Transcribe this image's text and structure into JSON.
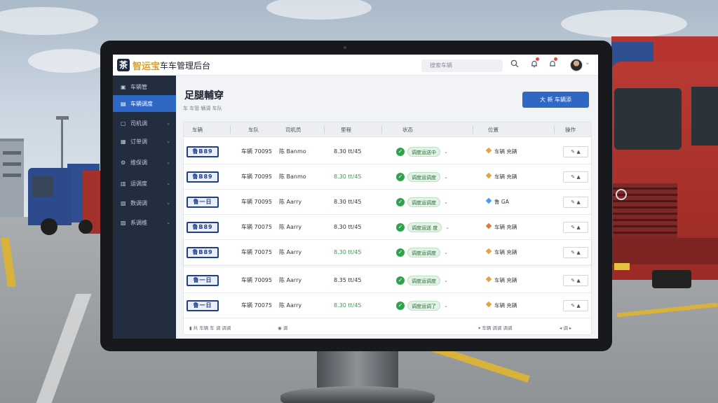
{
  "app": {
    "logo_glyph": "茶",
    "brand_name": "智运宝",
    "brand_suffix": "车车管理后台"
  },
  "topbar": {
    "search_placeholder": "搜索车辆",
    "search_icon": "search-icon",
    "bell_icon": "bell-icon",
    "alert_icon": "alert-icon"
  },
  "sidebar": {
    "items": [
      {
        "label": "车辆管",
        "icon": "dashboard-icon",
        "active": false,
        "caret": false
      },
      {
        "label": "车辆调度",
        "icon": "truck-icon",
        "active": true,
        "caret": false
      },
      {
        "label": "司机调",
        "icon": "driver-icon",
        "active": false,
        "caret": true
      },
      {
        "label": "订单调",
        "icon": "order-icon",
        "active": false,
        "caret": true
      },
      {
        "label": "维保调",
        "icon": "maintenance-icon",
        "active": false,
        "caret": true
      },
      {
        "label": "运调度",
        "icon": "route-icon",
        "active": false,
        "caret": true
      },
      {
        "label": "数调调",
        "icon": "data-icon",
        "active": false,
        "caret": true
      },
      {
        "label": "系调维",
        "icon": "settings-icon",
        "active": false,
        "caret": true
      }
    ]
  },
  "page": {
    "title": "足腿輔穿",
    "subtitle": "车 车管 辆调 车队",
    "primary_button": "大 新 车辆添"
  },
  "table": {
    "headers": [
      "车辆",
      "车队",
      "司机员",
      "里程",
      "状态",
      "位置",
      "操作"
    ],
    "rows": [
      {
        "plate": "鲁B89",
        "id": "车辆 70095",
        "driver": "陈 Banmo",
        "mileage": "8.30 tt/45",
        "mileage_green": false,
        "status": "调度运送中",
        "location": "车辆 充辆",
        "loc_color": "#e6a23c",
        "action": "✎ ▲"
      },
      {
        "plate": "鲁B89",
        "id": "车辆 70095",
        "driver": "陈 Banmo",
        "mileage": "8.30 tt/45",
        "mileage_green": true,
        "status": "调度运调度",
        "location": "车辆 充辆",
        "loc_color": "#e6a23c",
        "action": "✎ ▲"
      },
      {
        "plate": "鲁一日",
        "id": "车辆 70095",
        "driver": "陈 Aarry",
        "mileage": "8.30 tt/45",
        "mileage_green": false,
        "status": "调度运调度",
        "location": "鲁 GA",
        "loc_color": "#409eff",
        "action": "✎ ▲"
      },
      {
        "plate": "鲁B89",
        "id": "车辆 70075",
        "driver": "陈 Aarry",
        "mileage": "8.30 tt/45",
        "mileage_green": false,
        "status": "调度运送 度",
        "location": "车辆 充辆",
        "loc_color": "#d97a3a",
        "action": "✎ ▲"
      },
      {
        "plate": "鲁B89",
        "id": "车辆 70075",
        "driver": "陈 Aarry",
        "mileage": "8.30 tt/45",
        "mileage_green": true,
        "status": "调度运调度",
        "location": "车辆 充辆",
        "loc_color": "#e6a23c",
        "action": "✎ ▲"
      },
      {
        "plate": "鲁一日",
        "id": "车辆 70095",
        "driver": "陈 Aarry",
        "mileage": "8.35 tt/45",
        "mileage_green": false,
        "status": "调度运调度",
        "location": "车辆 充辆",
        "loc_color": "#e6a23c",
        "action": "✎ ▲"
      },
      {
        "plate": "鲁一日",
        "id": "车辆 70075",
        "driver": "陈 Aarry",
        "mileage": "8.30 tt/45",
        "mileage_green": true,
        "status": "调度运调了",
        "location": "车辆 充辆",
        "loc_color": "#e6a23c",
        "action": "✎ ▲"
      }
    ],
    "footer": {
      "left": "▮ 共 车辆 车 调 调调",
      "mid": "◉ 调",
      "right": "▾ 车辆 调调 调调",
      "pager": "◂ 调 ▸"
    }
  }
}
